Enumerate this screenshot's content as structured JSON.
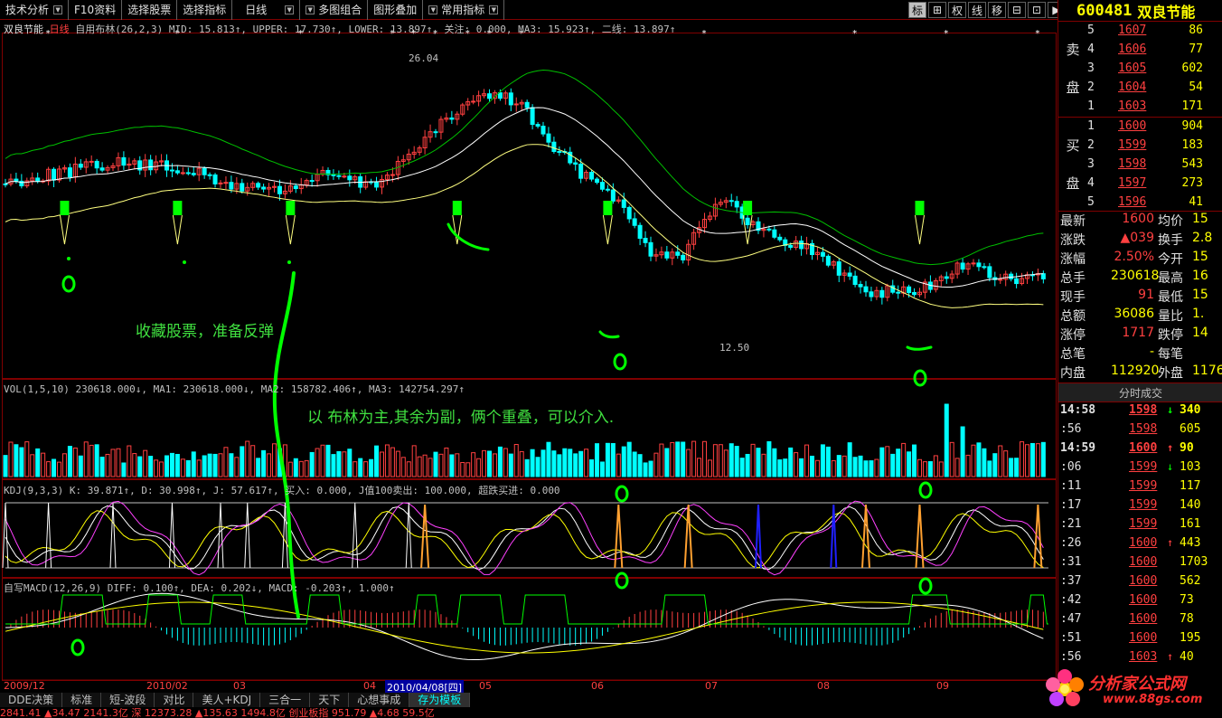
{
  "toolbar": {
    "items": [
      "技术分析",
      "F10资料",
      "选择股票",
      "选择指标",
      "日线",
      "多图组合",
      "图形叠加",
      "常用指标"
    ],
    "tools": [
      "标",
      "⊞",
      "权",
      "线",
      "移",
      "⊟",
      "⊡",
      "▶"
    ]
  },
  "stock": {
    "code": "600481",
    "name": "双良节能"
  },
  "chart": {
    "header_name": "双良节能",
    "header_period": "日线",
    "header_rest": "自用布林(26,2,3) MID: 15.813↑, UPPER: 17.730↑, LOWER: 13.897↑, 关注: 0.000, MA3: 15.923↑, 二线: 13.897↑",
    "price_high": "26.04",
    "price_low": "12.50",
    "vol_title": "VOL(1,5,10) 230618.000↓, MA1: 230618.000↓, MA2: 158782.406↑, MA3: 142754.297↑",
    "kdj_title": "KDJ(9,3,3) K: 39.871↑, D: 30.998↑, J: 57.617↑, 买入: 0.000, J值100卖出: 100.000, 超跌买进: 0.000",
    "macd_title": "自写MACD(12,26,9) DIFF: 0.100↑, DEA: 0.202↓, MACD: -0.203↑, 1.000↑",
    "dates": [
      "2009/12",
      "2010/02",
      "03",
      "04",
      "2010/04/08[四]",
      "05",
      "06",
      "07",
      "08",
      "09"
    ],
    "annot1": "收藏股票，准备反弹",
    "annot2": "以  布林为主,其余为副，俩个重叠，可以介入."
  },
  "orderbook": {
    "sell_label_1": "卖",
    "sell_label_2": "盘",
    "buy_label_1": "买",
    "buy_label_2": "盘",
    "sells": [
      {
        "lv": "5",
        "price": "1607",
        "vol": "86"
      },
      {
        "lv": "4",
        "price": "1606",
        "vol": "77"
      },
      {
        "lv": "3",
        "price": "1605",
        "vol": "602"
      },
      {
        "lv": "2",
        "price": "1604",
        "vol": "54"
      },
      {
        "lv": "1",
        "price": "1603",
        "vol": "171"
      }
    ],
    "buys": [
      {
        "lv": "1",
        "price": "1600",
        "vol": "904"
      },
      {
        "lv": "2",
        "price": "1599",
        "vol": "183"
      },
      {
        "lv": "3",
        "price": "1598",
        "vol": "543"
      },
      {
        "lv": "4",
        "price": "1597",
        "vol": "273"
      },
      {
        "lv": "5",
        "price": "1596",
        "vol": "41"
      }
    ]
  },
  "stats": [
    {
      "l1": "最新",
      "v1": "1600",
      "l2": "均价",
      "v2": "15"
    },
    {
      "l1": "涨跌",
      "v1": "▲039",
      "l2": "换手",
      "v2": "2.8"
    },
    {
      "l1": "涨幅",
      "v1": "2.50%",
      "l2": "今开",
      "v2": "15"
    },
    {
      "l1": "总手",
      "v1": "230618",
      "l2": "最高",
      "v2": "16"
    },
    {
      "l1": "现手",
      "v1": "91",
      "l2": "最低",
      "v2": "15"
    },
    {
      "l1": "总额",
      "v1": "36086",
      "l2": "量比",
      "v2": "1."
    },
    {
      "l1": "涨停",
      "v1": "1717",
      "l2": "跌停",
      "v2": "14"
    },
    {
      "l1": "总笔",
      "v1": "-",
      "l2": "每笔",
      "v2": ""
    },
    {
      "l1": "内盘",
      "v1": "112920",
      "l2": "外盘",
      "v2": "1176"
    }
  ],
  "trades_title": "分时成交",
  "trades": [
    {
      "t": "14:58",
      "p": "1598",
      "a": "↓",
      "v": "340"
    },
    {
      "t": ":56",
      "p": "1598",
      "a": "",
      "v": "605"
    },
    {
      "t": "14:59",
      "p": "1600",
      "a": "↑",
      "v": "90"
    },
    {
      "t": ":06",
      "p": "1599",
      "a": "↓",
      "v": "103"
    },
    {
      "t": ":11",
      "p": "1599",
      "a": "",
      "v": "117"
    },
    {
      "t": ":17",
      "p": "1599",
      "a": "",
      "v": "140"
    },
    {
      "t": ":21",
      "p": "1599",
      "a": "",
      "v": "161"
    },
    {
      "t": ":26",
      "p": "1600",
      "a": "↑",
      "v": "443"
    },
    {
      "t": ":31",
      "p": "1600",
      "a": "",
      "v": "1703"
    },
    {
      "t": ":37",
      "p": "1600",
      "a": "",
      "v": "562"
    },
    {
      "t": ":42",
      "p": "1600",
      "a": "",
      "v": "73"
    },
    {
      "t": ":47",
      "p": "1600",
      "a": "",
      "v": "78"
    },
    {
      "t": ":51",
      "p": "1600",
      "a": "",
      "v": "195"
    },
    {
      "t": ":56",
      "p": "1603",
      "a": "↑",
      "v": "40"
    }
  ],
  "bottom_tabs": [
    "DDE决策",
    "标准",
    "短-波段",
    "对比",
    "美人+KDJ",
    "三合一",
    "天下",
    "心想事成",
    "存为模板"
  ],
  "ticker": "2841.41  ▲34.47  2141.3亿 深  12373.28  ▲135.63  1494.8亿 创业板指  951.79  ▲4.68  59.5亿",
  "logo": {
    "title": "分析家公式网",
    "url": "www.88gs.com"
  },
  "colors": {
    "up": "#ff4040",
    "down": "#00ffff",
    "mid": "#ffffff",
    "upper": "#00c000",
    "lower": "#ffff80",
    "green": "#00ff00",
    "orange": "#ffa030",
    "magenta": "#ff40ff",
    "yellow": "#ffff00"
  }
}
